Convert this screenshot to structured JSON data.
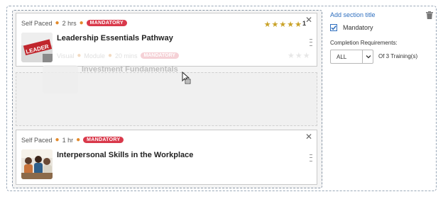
{
  "card1": {
    "pace": "Self Paced",
    "duration": "2 hrs",
    "badge": "MANDATORY",
    "title": "Leadership Essentials Pathway",
    "thumb_text": "LEADER",
    "stars": "★★★★★",
    "rating_count": "1"
  },
  "ghost": {
    "pace": "Visual",
    "type": "Module",
    "duration": "20 mins",
    "badge": "MANDATORY",
    "title": "Investment Fundamentals",
    "stars": "★★★"
  },
  "card3": {
    "pace": "Self Paced",
    "duration": "1 hr",
    "badge": "MANDATORY",
    "title": "Interpersonal Skills in the Workplace"
  },
  "panel": {
    "add_section_title": "Add section title",
    "mandatory_label": "Mandatory",
    "mandatory_checked": true,
    "completion_label": "Completion Requirements:",
    "completion_value": "ALL",
    "of_text": "Of 3 Training(s)"
  },
  "colors": {
    "badge": "#d9394b",
    "link": "#2f6fbf",
    "star": "#c9a227",
    "dot": "#e38a2b"
  },
  "icons": {
    "close": "close-icon",
    "drag": "drag-handle-icon",
    "trash": "trash-icon",
    "chevron": "chevron-down-icon",
    "cursor": "move-cursor-icon"
  }
}
